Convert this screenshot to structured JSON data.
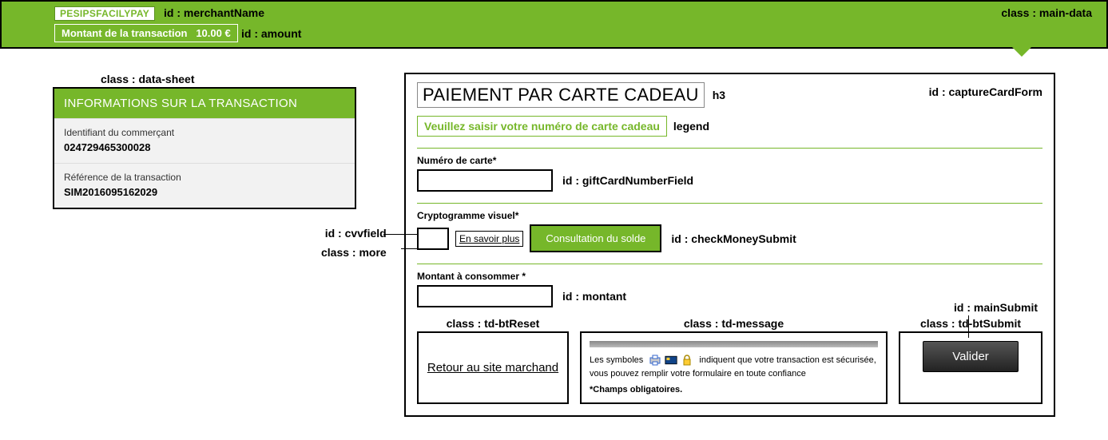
{
  "mainData": {
    "merchantName": "PESIPSFACILYPAY",
    "amountLabel": "Montant de la transaction",
    "amountValue": "10.00 €"
  },
  "annotations": {
    "merchantId": "id : merchantName",
    "amountId": "id : amount",
    "mainDataClass": "class : main-data",
    "dataSheetClass": "class : data-sheet",
    "captureForm": "id : captureCardForm",
    "h3": "h3",
    "legend": "legend",
    "giftCardField": "id : giftCardNumberField",
    "cvvField": "id : cvvfield",
    "moreClass": "class : more",
    "checkMoney": "id : checkMoneySubmit",
    "montant": "id : montant",
    "tdReset": "class : td-btReset",
    "tdMessage": "class : td-message",
    "tdSubmit": "class : td-btSubmit",
    "mainSubmit": "id : mainSubmit"
  },
  "dataSheet": {
    "header": "INFORMATIONS SUR LA TRANSACTION",
    "merchantIdLabel": "Identifiant du commerçant",
    "merchantIdValue": "024729465300028",
    "transRefLabel": "Référence de la transaction",
    "transRefValue": "SIM2016095162029"
  },
  "form": {
    "h3": "PAIEMENT PAR CARTE CADEAU",
    "legend": "Veuillez saisir votre numéro de carte cadeau",
    "cardNumLabel": "Numéro de carte*",
    "cvvLabel": "Cryptogramme visuel*",
    "moreLink": "En savoir plus",
    "checkBalance": "Consultation du solde",
    "amountLabel": "Montant à consommer *",
    "resetLink": "Retour au site marchand",
    "messagePrefix": "Les symboles",
    "messageSuffix": "indiquent que votre transaction est sécurisée, vous pouvez remplir votre formulaire en toute confiance",
    "mandatory": "*Champs obligatoires.",
    "submit": "Valider"
  }
}
